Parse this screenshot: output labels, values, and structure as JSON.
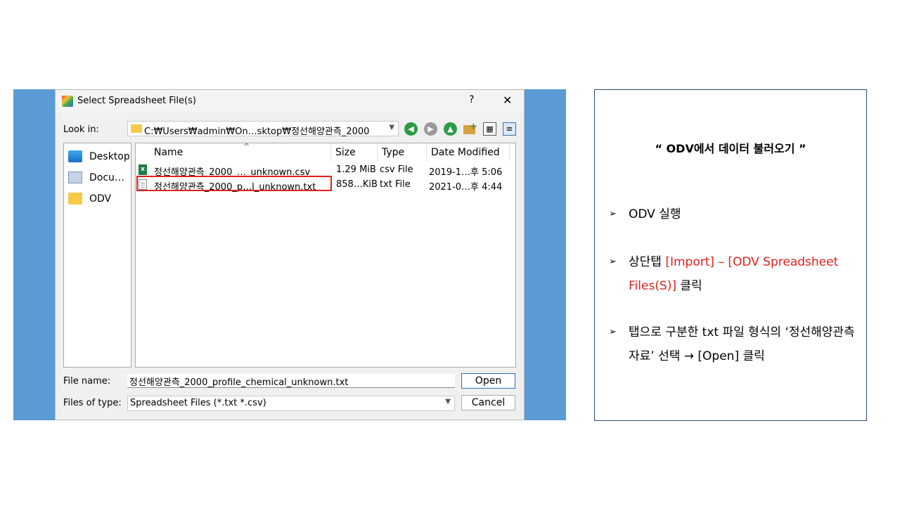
{
  "dialog": {
    "title": "Select Spreadsheet File(s)",
    "help": "?",
    "close": "✕",
    "look_in_label": "Look in:",
    "path": "C:₩Users₩admin₩On…sktop₩정선해양관측_2000",
    "sidebar": [
      {
        "label": "Desktop",
        "icon": "desktop-icon"
      },
      {
        "label": "Docu…",
        "icon": "documents-icon"
      },
      {
        "label": "ODV",
        "icon": "folder-icon"
      }
    ],
    "columns": [
      "Name",
      "Size",
      "Type",
      "Date Modified"
    ],
    "files": [
      {
        "name": "정선해양관측_2000_…_unknown.csv",
        "size": "1.29 MiB",
        "type": "csv File",
        "date": "2019-1…후 5:06",
        "icon": "csv-file-icon"
      },
      {
        "name": "정선해양관측_2000_p…l_unknown.txt",
        "size": "858…KiB",
        "type": "txt File",
        "date": "2021-0…후 4:44",
        "icon": "txt-file-icon"
      }
    ],
    "file_name_label": "File name:",
    "file_name_value": "정선해양관측_2000_profile_chemical_unknown.txt",
    "file_type_label": "Files of type:",
    "file_type_value": "Spreadsheet Files (*.txt *.csv)",
    "open_button": "Open",
    "cancel_button": "Cancel"
  },
  "panel": {
    "title": "“ ODV에서 데이터 불러오기 ”",
    "bullet_glyph": "➢",
    "step1": "ODV 실행",
    "step2_pre": "상단탭 ",
    "step2_red": "[Import] – [ODV Spreadsheet Files(S)]",
    "step2_post": " 클릭",
    "step3": "탭으로 구분한 txt 파일 형식의 ‘정선해양관측자료’ 선택 → [Open] 클릭"
  }
}
